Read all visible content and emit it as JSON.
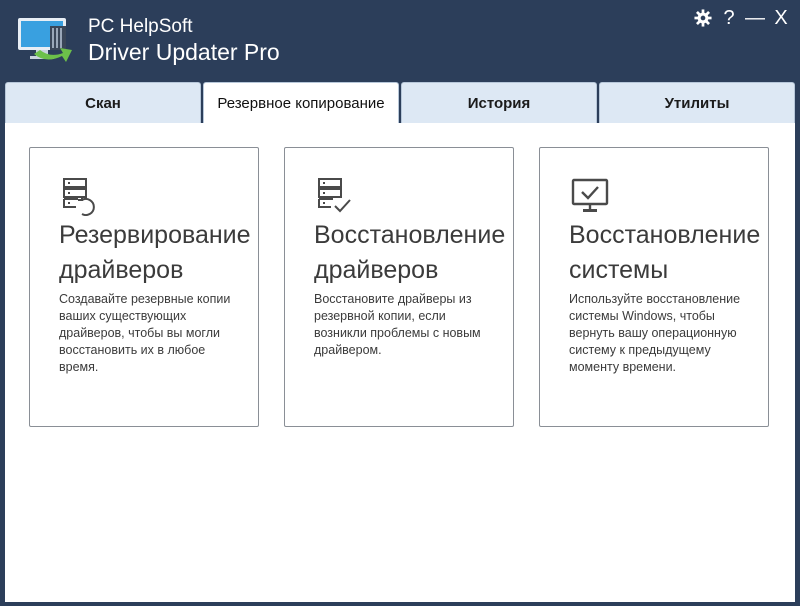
{
  "app": {
    "brand": "PC HelpSoft",
    "product": "Driver Updater Pro"
  },
  "window_controls": {
    "settings_icon": "gear-icon",
    "help_label": "?",
    "minimize_label": "—",
    "close_label": "X"
  },
  "tabs": [
    {
      "label": "Скан",
      "active": false
    },
    {
      "label": "Резервное копирование",
      "active": true
    },
    {
      "label": "История",
      "active": false
    },
    {
      "label": "Утилиты",
      "active": false
    }
  ],
  "cards": [
    {
      "icon": "server-restore-icon",
      "title_line1": "Резервирование",
      "title_line2": "драйверов",
      "description": "Создавайте резервные копии ваших существующих драйверов, чтобы вы могли восстановить их в любое время."
    },
    {
      "icon": "server-check-icon",
      "title_line1": "Восстановление",
      "title_line2": "драйверов",
      "description": "Восстановите драйверы из резервной копии, если возникли проблемы с новым драйвером."
    },
    {
      "icon": "monitor-check-icon",
      "title_line1": "Восстановление",
      "title_line2": "системы",
      "description": "Используйте восстановление системы Windows, чтобы вернуть вашу операционную систему к предыдущему моменту времени."
    }
  ],
  "colors": {
    "header_bg": "#2c3e5a",
    "tab_bg": "#dde8f4",
    "accent_green": "#6cc04a"
  }
}
